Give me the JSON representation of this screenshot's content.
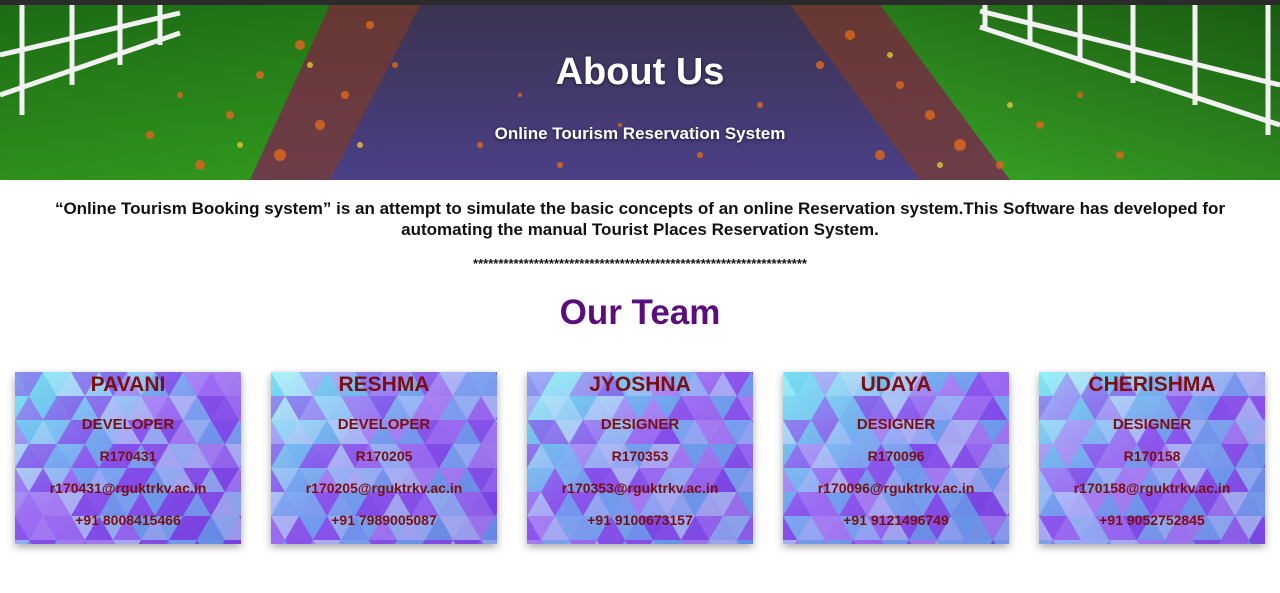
{
  "header": {
    "title": "About Us",
    "subtitle": "Online Tourism Reservation System"
  },
  "intro": {
    "text": "“Online Tourism Booking system” is an attempt to simulate the basic concepts of an online Reservation system.This Software has developed for automating the manual Tourist Places Reservation System.",
    "separator": "******************************************************************"
  },
  "team": {
    "heading": "Our Team",
    "members": [
      {
        "name": "PAVANI",
        "role": "DEVELOPER",
        "id": "R170431",
        "email": "r170431@rguktrkv.ac.in",
        "phone": "+91 8008415466"
      },
      {
        "name": "RESHMA",
        "role": "DEVELOPER",
        "id": "R170205",
        "email": "r170205@rguktrkv.ac.in",
        "phone": "+91 7989005087"
      },
      {
        "name": "JYOSHNA",
        "role": "DESIGNER",
        "id": "R170353",
        "email": "r170353@rguktrkv.ac.in",
        "phone": "+91 9100673157"
      },
      {
        "name": "UDAYA",
        "role": "DESIGNER",
        "id": "R170096",
        "email": "r170096@rguktrkv.ac.in",
        "phone": "+91 9121496749"
      },
      {
        "name": "CHERISHMA",
        "role": "DESIGNER",
        "id": "R170158",
        "email": "r170158@rguktrkv.ac.in",
        "phone": "+91 9052752845"
      }
    ]
  },
  "colors": {
    "heading_purple": "#5a0f7d",
    "card_text": "#7a0f12",
    "card_bg_light": "#7fe8f2",
    "card_bg_dark": "#7b3fe4"
  }
}
